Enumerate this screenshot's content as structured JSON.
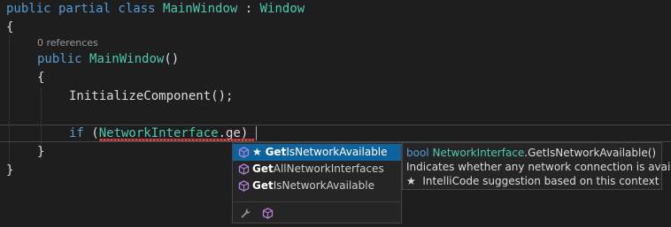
{
  "editor": {
    "lines": [
      {
        "tokens": [
          {
            "t": "public partial class ",
            "c": "kw"
          },
          {
            "t": "MainWindow",
            "c": "type"
          },
          {
            "t": " : ",
            "c": "plain"
          },
          {
            "t": "Window",
            "c": "type"
          }
        ]
      },
      {
        "tokens": [
          {
            "t": "{",
            "c": "plain"
          }
        ]
      },
      {
        "tokens": [
          {
            "t": "public ",
            "c": "kw"
          },
          {
            "t": "MainWindow",
            "c": "type"
          },
          {
            "t": "()",
            "c": "plain"
          }
        ]
      },
      {
        "tokens": [
          {
            "t": "{",
            "c": "plain"
          }
        ]
      },
      {
        "tokens": [
          {
            "t": "InitializeComponent();",
            "c": "plain"
          }
        ]
      },
      {
        "tokens": [
          {
            "t": "if",
            "c": "kw"
          },
          {
            "t": " (",
            "c": "plain"
          },
          {
            "t": "NetworkInterface",
            "c": "type"
          },
          {
            "t": ".ge)",
            "c": "plain"
          }
        ]
      },
      {
        "tokens": [
          {
            "t": "}",
            "c": "plain"
          }
        ]
      },
      {
        "tokens": [
          {
            "t": "}",
            "c": "plain"
          }
        ]
      }
    ],
    "codelens": "0 references"
  },
  "completion": {
    "items": [
      {
        "prefix": "★ ",
        "bold": "Get",
        "rest": "IsNetworkAvailable",
        "icon": "method-cube-icon",
        "selected": true
      },
      {
        "prefix": "",
        "bold": "Get",
        "rest": "AllNetworkInterfaces",
        "icon": "method-cube-icon",
        "selected": false
      },
      {
        "prefix": "",
        "bold": "Get",
        "rest": "IsNetworkAvailable",
        "icon": "method-cube-icon",
        "selected": false
      }
    ],
    "footer_icons": [
      "wrench-icon",
      "method-filter-icon"
    ]
  },
  "quickinfo": {
    "signature_kw": "bool",
    "signature_type": "NetworkInterface",
    "signature_rest": ".GetIsNetworkAvailable()",
    "description": "Indicates whether any network connection is available.",
    "intellicode": "★  IntelliCode suggestion based on this context"
  },
  "colors": {
    "background": "#1e1e1e",
    "keyword": "#569cd6",
    "type": "#4ec9b0",
    "selection": "#0e639c",
    "error_squiggle": "#f14c4c",
    "method_icon": "#b180d7"
  }
}
